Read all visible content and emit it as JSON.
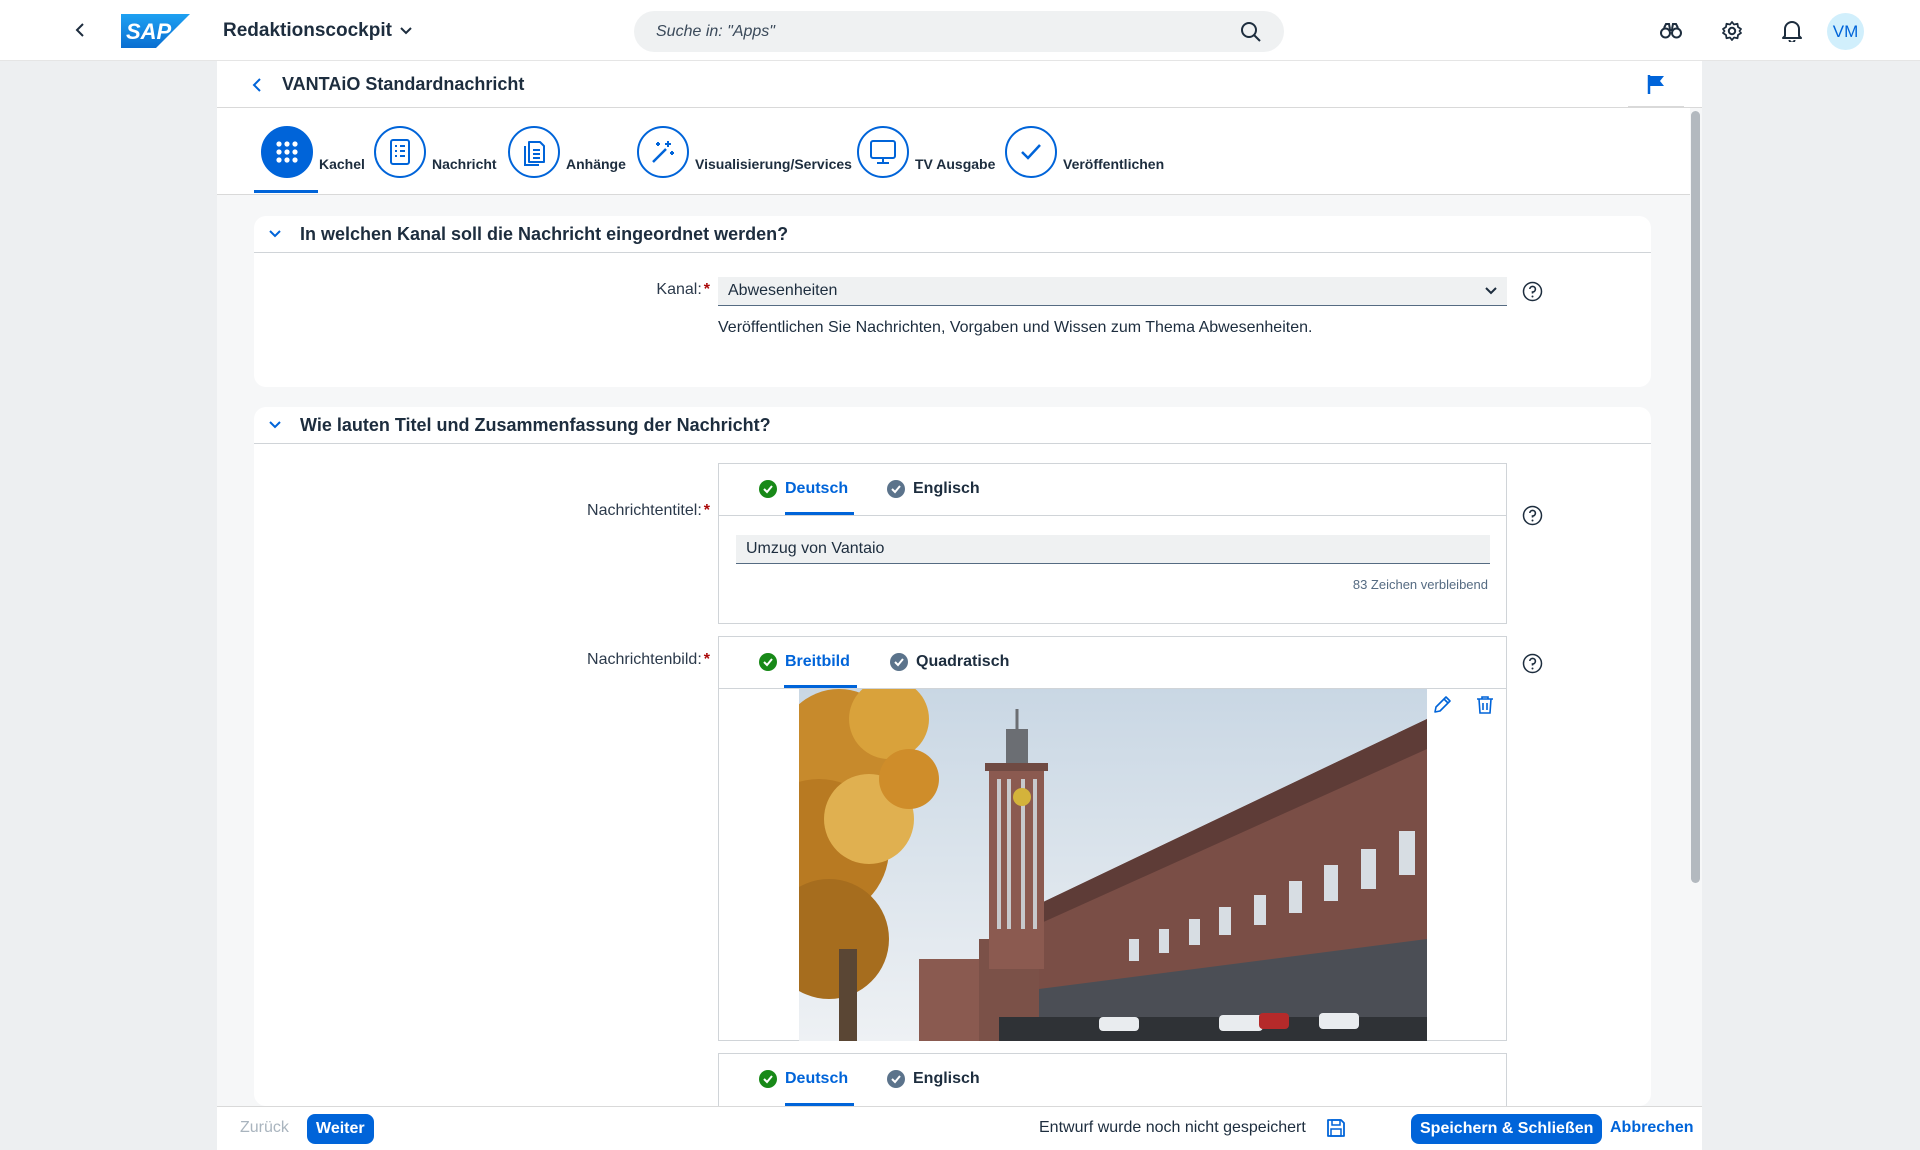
{
  "shell": {
    "app_title": "Redaktionscockpit",
    "search_placeholder": "Suche in: \"Apps\"",
    "avatar_initials": "VM",
    "logo_text": "SAP"
  },
  "header": {
    "title": "VANTAiO Standardnachricht"
  },
  "wizard": {
    "steps": [
      {
        "label": "Kachel",
        "icon": "grid-icon",
        "active": true
      },
      {
        "label": "Nachricht",
        "icon": "document-list-icon",
        "active": false
      },
      {
        "label": "Anhänge",
        "icon": "attachment-docs-icon",
        "active": false
      },
      {
        "label": "Visualisierung/Services",
        "icon": "magic-wand-icon",
        "active": false
      },
      {
        "label": "TV Ausgabe",
        "icon": "monitor-icon",
        "active": false
      },
      {
        "label": "Veröffentlichen",
        "icon": "checkmark-icon",
        "active": false
      }
    ]
  },
  "section_channel": {
    "title": "In welchen Kanal soll die Nachricht eingeordnet werden?",
    "label": "Kanal:",
    "required_mark": "*",
    "selected_value": "Abwesenheiten",
    "description": "Veröffentlichen Sie Nachrichten, Vorgaben und Wissen zum Thema Abwesenheiten."
  },
  "section_title": {
    "title": "Wie lauten Titel und Zusammenfassung der Nachricht?",
    "title_label": "Nachrichtentitel:",
    "image_label": "Nachrichtenbild:",
    "required_mark": "*",
    "lang_tabs": [
      "Deutsch",
      "Englisch"
    ],
    "image_tabs": [
      "Breitbild",
      "Quadratisch"
    ],
    "title_value": "Umzug von Vantaio",
    "chars_remaining": "83 Zeichen verbleibend"
  },
  "footer": {
    "back_label": "Zurück",
    "next_label": "Weiter",
    "draft_status": "Entwurf wurde noch nicht gespeichert",
    "save_close_label": "Speichern & Schließen",
    "cancel_label": "Abbrechen"
  },
  "colors": {
    "brand_blue": "#0064d9",
    "success_green": "#188918",
    "neutral_grey": "#5b738b",
    "required_red": "#aa0808"
  }
}
